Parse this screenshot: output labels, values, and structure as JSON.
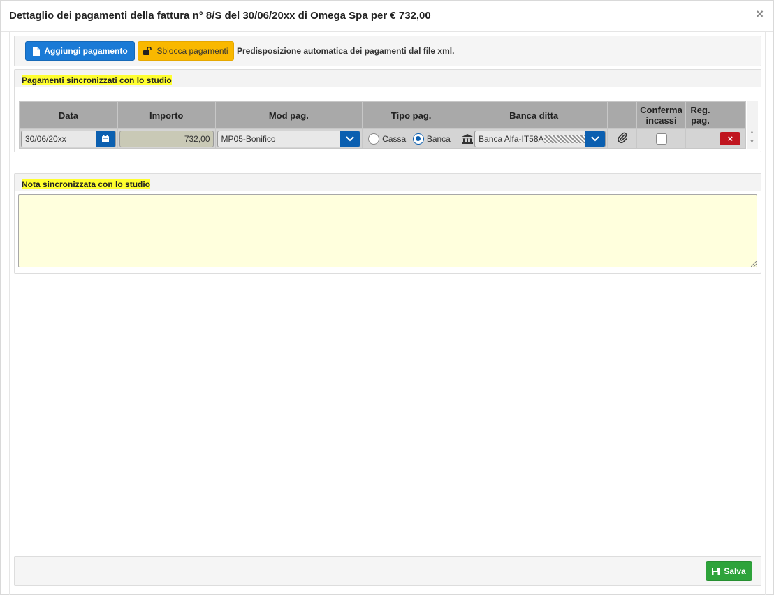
{
  "modal": {
    "title": "Dettaglio dei pagamenti della fattura n° 8/S del 30/06/20xx di Omega Spa per € 732,00",
    "close_label": "×"
  },
  "toolbar": {
    "add_label": "Aggiungi pagamento",
    "unlock_label": "Sblocca pagamenti",
    "auto_text": "Predisposizione automatica dei pagamenti dal file xml."
  },
  "payments": {
    "title": "Pagamenti sincronizzati con lo studio",
    "columns": {
      "data": "Data",
      "importo": "Importo",
      "mod_pag": "Mod pag.",
      "tipo_pag": "Tipo pag.",
      "banca_ditta": "Banca ditta",
      "attach": "",
      "conferma_line1": "Conferma",
      "conferma_line2": "incassi",
      "reg_line1": "Reg.",
      "reg_line2": "pag.",
      "actions": ""
    },
    "rows": [
      {
        "data": "30/06/20xx",
        "importo": "732,00",
        "mod_pag": "MP05-Bonifico",
        "tipo_cassa": "Cassa",
        "tipo_banca": "Banca",
        "tipo_selected": "Banca",
        "banca": "Banca Alfa-IT58A",
        "conferma_incassi": false,
        "delete_label": "×"
      }
    ]
  },
  "note": {
    "title": "Nota sincronizzata con lo studio",
    "value": ""
  },
  "footer": {
    "save_label": "Salva"
  },
  "colors": {
    "primary": "#1a7ad6",
    "warning": "#f9b800",
    "success": "#2ea33b",
    "danger": "#c0151f",
    "highlight": "#ffff30",
    "note_bg": "#ffffdd"
  }
}
